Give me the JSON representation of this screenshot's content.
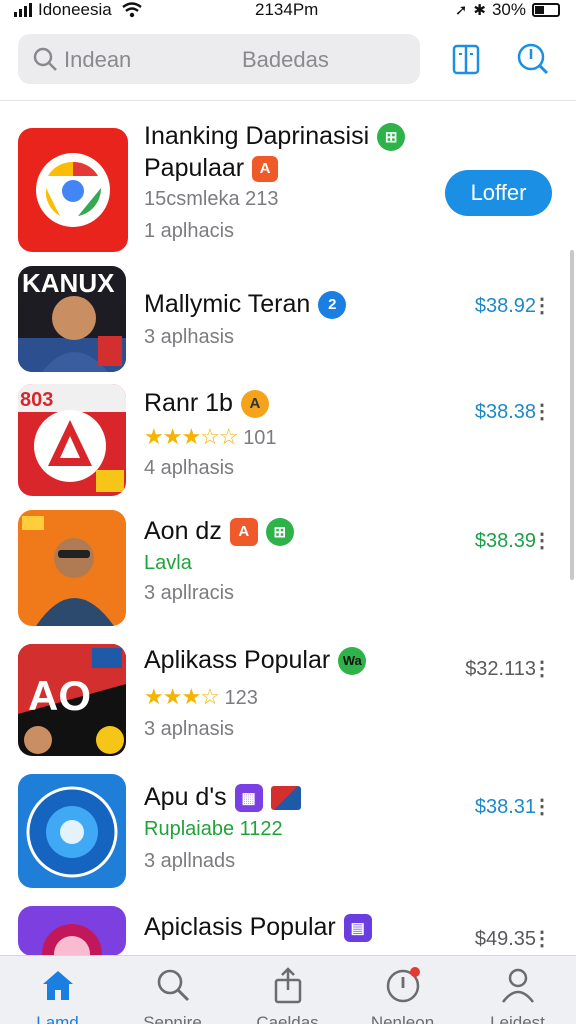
{
  "status_bar": {
    "carrier": "Idoneesia",
    "time": "2134Pm",
    "battery": "30%"
  },
  "search": {
    "placeholder": "Indean",
    "secondary": "Badedas"
  },
  "header_icons": [
    "book-icon",
    "search-refresh-icon"
  ],
  "apps": [
    {
      "title": "Inanking Daprinasisi",
      "title_line2": "Papulaar",
      "sub1": "15csmleka  213",
      "sub2": "1 aplhacis",
      "action": "Loffer",
      "colors": {
        "icon_bg": "#e8241c"
      }
    },
    {
      "title": "Mallymic Teran",
      "badge": "2",
      "sub2": "3 aplhasis",
      "price": "$38.92",
      "icon_text": "KANUX"
    },
    {
      "title": "Ranr 1b",
      "badge": "A",
      "rating": "101",
      "sub2": "4 aplhasis",
      "price": "$38.38",
      "icon_text": "803"
    },
    {
      "title": "Aon dz",
      "sub1": "Lavla",
      "sub2": "3 apllracis",
      "price": "$38.39"
    },
    {
      "title": "Aplikass Popular",
      "badge": "Wa",
      "rating": "123",
      "sub2": "3 aplnasis",
      "price": "$32.113",
      "icon_text": "AO"
    },
    {
      "title": "Apu d's",
      "sub1": "Ruplaiabe 1122",
      "sub2": "3 apllnads",
      "price": "$38.31"
    },
    {
      "title": "Apiclasis Popular",
      "price": "$49.35"
    }
  ],
  "tabs": [
    {
      "label": "Lamd",
      "icon": "home-icon",
      "active": true
    },
    {
      "label": "Sepnire",
      "icon": "search-icon",
      "active": false
    },
    {
      "label": "Caeldas",
      "icon": "share-icon",
      "active": false
    },
    {
      "label": "Nenleon",
      "icon": "alert-icon",
      "active": false
    },
    {
      "label": "Leidest",
      "icon": "person-icon",
      "active": false
    }
  ],
  "colors": {
    "accent": "#1a8fe3",
    "price_blue": "#1e88c8",
    "price_green": "#1ea04a",
    "text_green": "#22a33a"
  }
}
